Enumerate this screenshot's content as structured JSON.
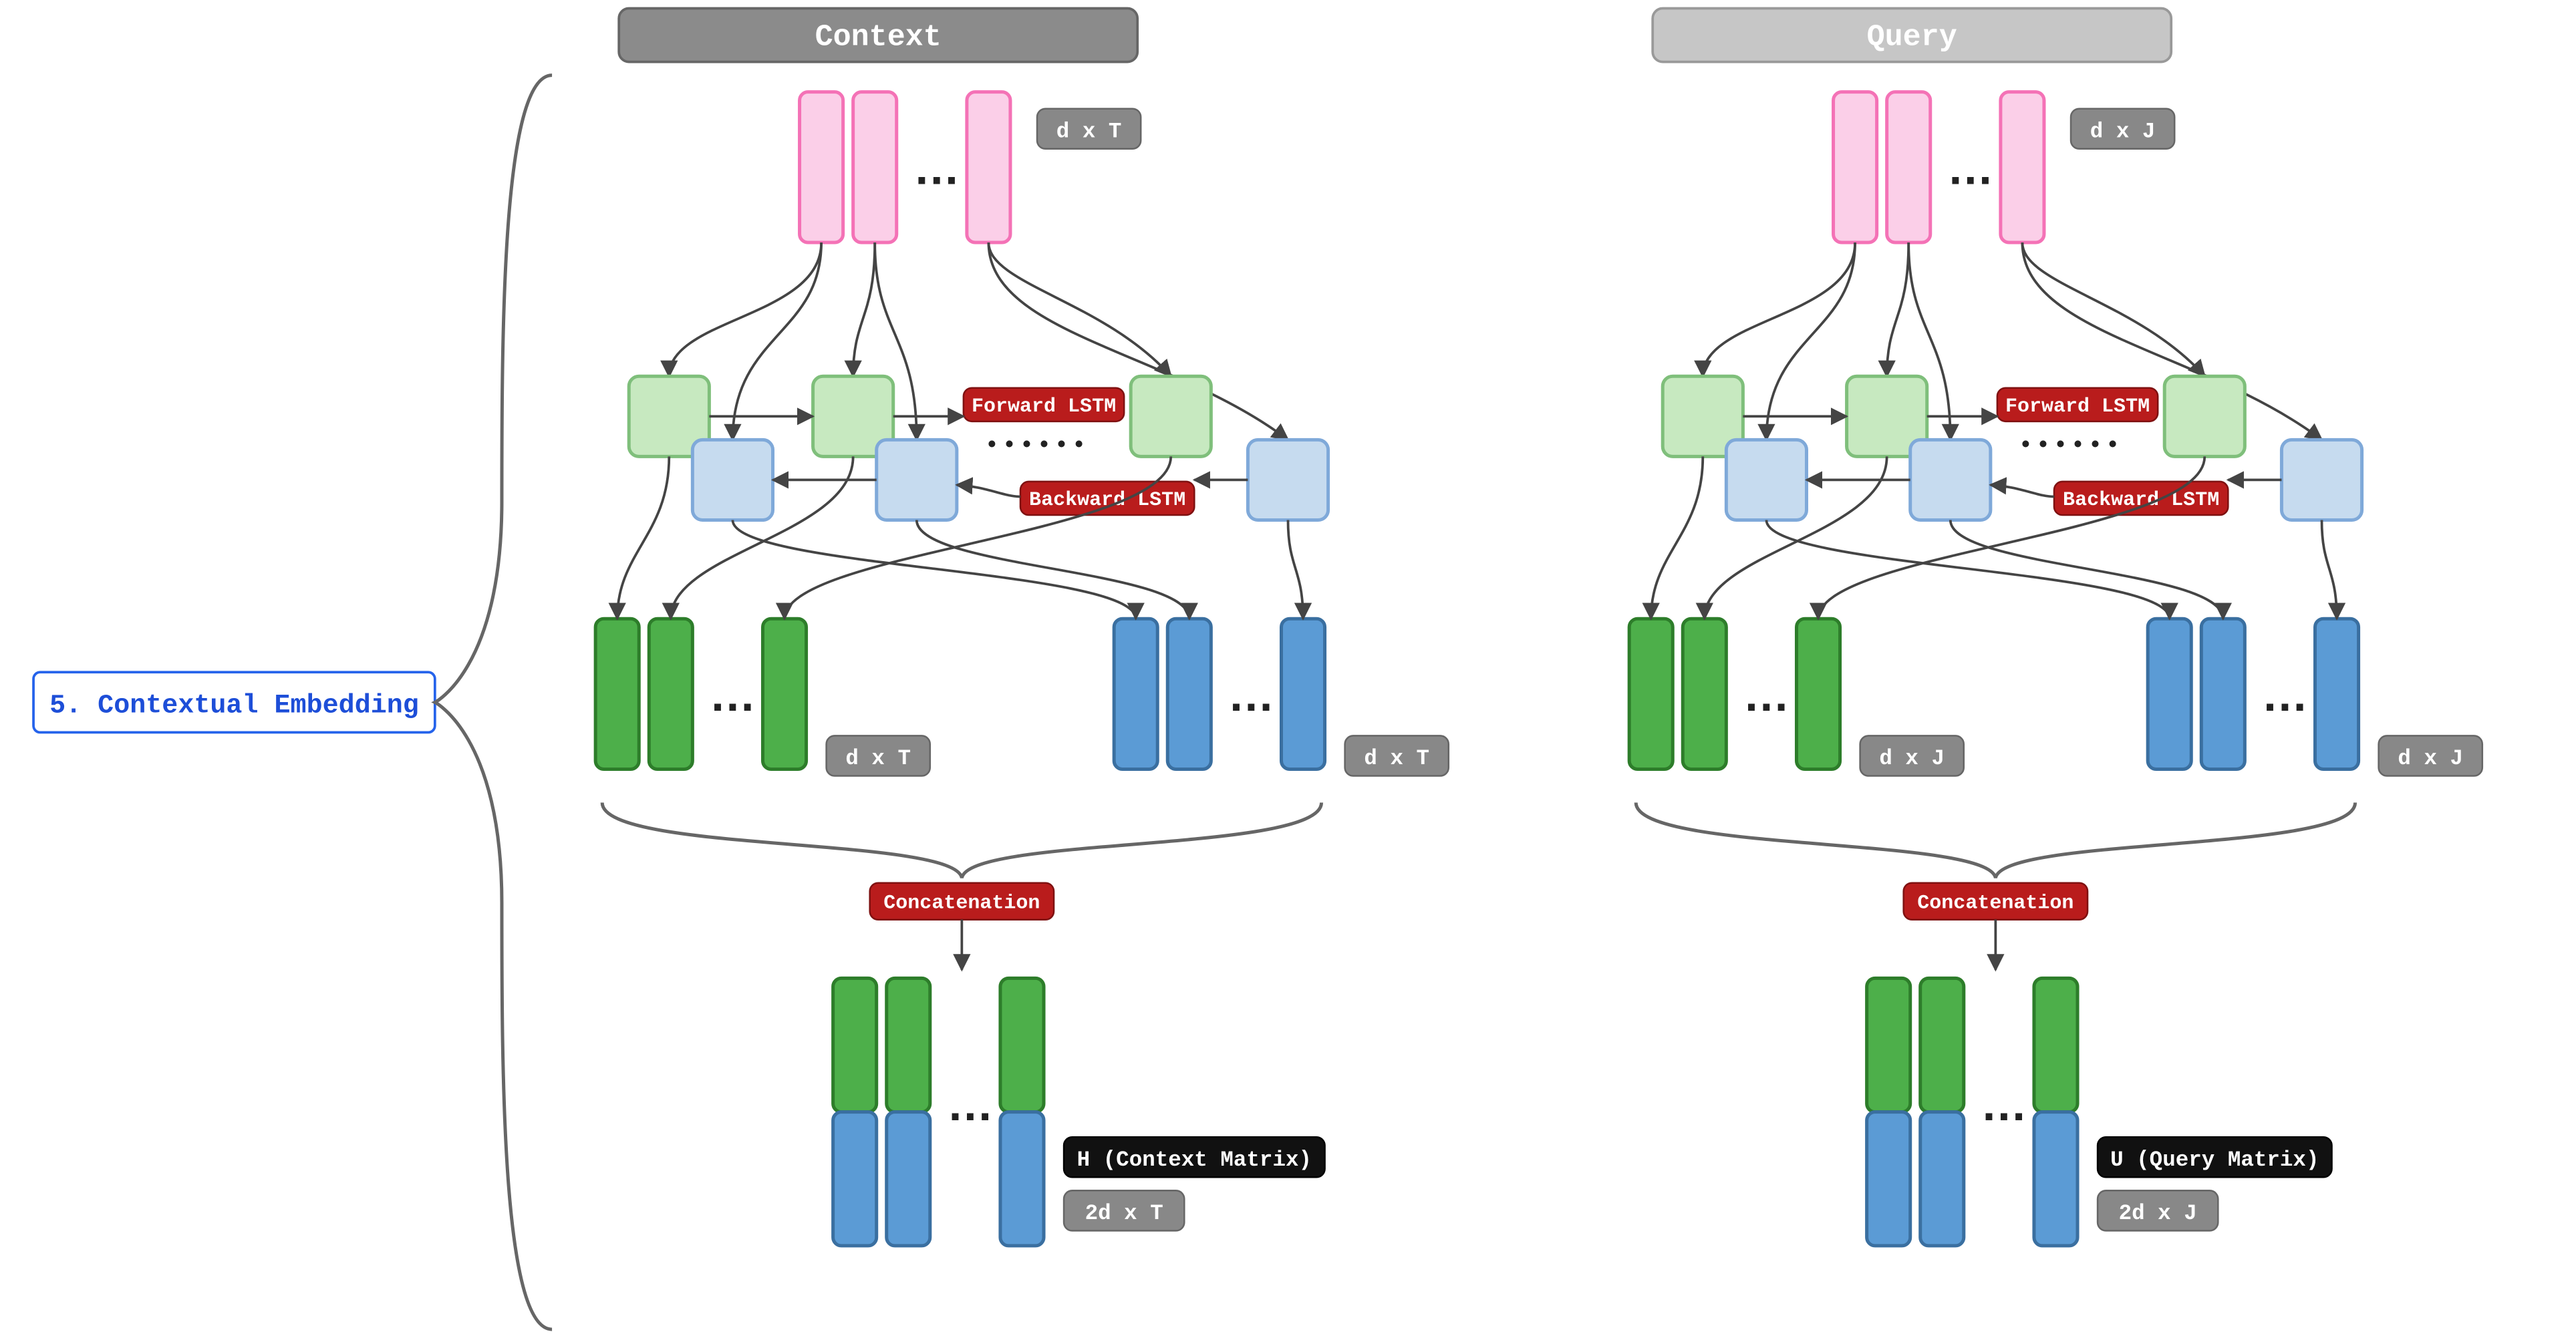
{
  "side_label": "5. Contextual Embedding",
  "context": {
    "header": "Context",
    "input_dim": "d x T",
    "forward_lstm": "Forward LSTM",
    "backward_lstm": "Backward LSTM",
    "fwd_dim": "d x T",
    "bwd_dim": "d x T",
    "concat": "Concatenation",
    "out_name": "H (Context Matrix)",
    "out_dim": "2d x T"
  },
  "query": {
    "header": "Query",
    "input_dim": "d x J",
    "forward_lstm": "Forward LSTM",
    "backward_lstm": "Backward LSTM",
    "fwd_dim": "d x J",
    "bwd_dim": "d x J",
    "concat": "Concatenation",
    "out_name": "U (Query Matrix)",
    "out_dim": "2d x J"
  }
}
